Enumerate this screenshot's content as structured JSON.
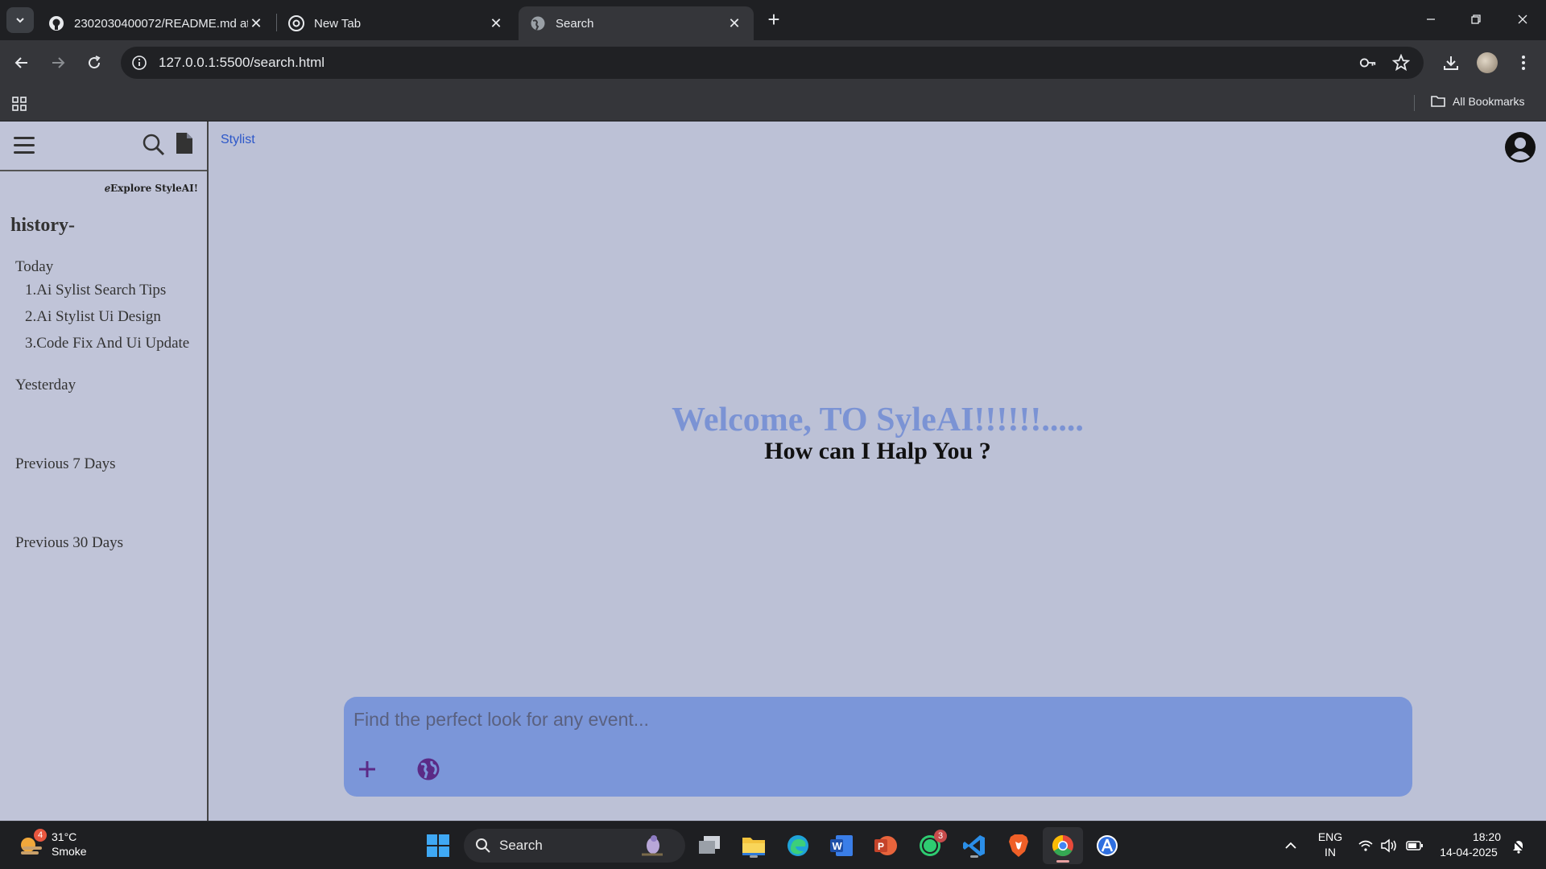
{
  "browser": {
    "tabs": [
      {
        "title": "2302030400072/README.md at",
        "icon": "github-icon"
      },
      {
        "title": "New Tab",
        "icon": "chrome-icon"
      },
      {
        "title": "Search",
        "icon": "globe-icon",
        "active": true
      }
    ],
    "url": "127.0.0.1:5500/search.html",
    "bookmarks_label": "All Bookmarks"
  },
  "sidebar": {
    "explore": "Explore StyleAI!",
    "history_title": "history-",
    "today_label": "Today",
    "today_items": [
      "1.Ai Sylist Search Tips",
      "2.Ai Stylist Ui Design",
      "3.Code Fix And Ui Update"
    ],
    "yesterday_label": "Yesterday",
    "prev7_label": "Previous 7 Days",
    "prev30_label": "Previous 30 Days"
  },
  "main": {
    "brand_link": "Stylist",
    "welcome": "Welcome, TO SyleAI!!!!!!.....",
    "help": "How can I Halp You ?",
    "input_placeholder": "Find the perfect look for any event..."
  },
  "taskbar": {
    "weather_temp": "31°C",
    "weather_desc": "Smoke",
    "weather_badge": "4",
    "search_label": "Search",
    "whatsapp_badge": "3",
    "lang_top": "ENG",
    "lang_bottom": "IN",
    "time": "18:20",
    "date": "14-04-2025"
  },
  "colors": {
    "page_bg": "#bcc1d6",
    "welcome": "#7b93d4",
    "input_bg": "#7b96d9",
    "icon_purple": "#5b2a86"
  }
}
